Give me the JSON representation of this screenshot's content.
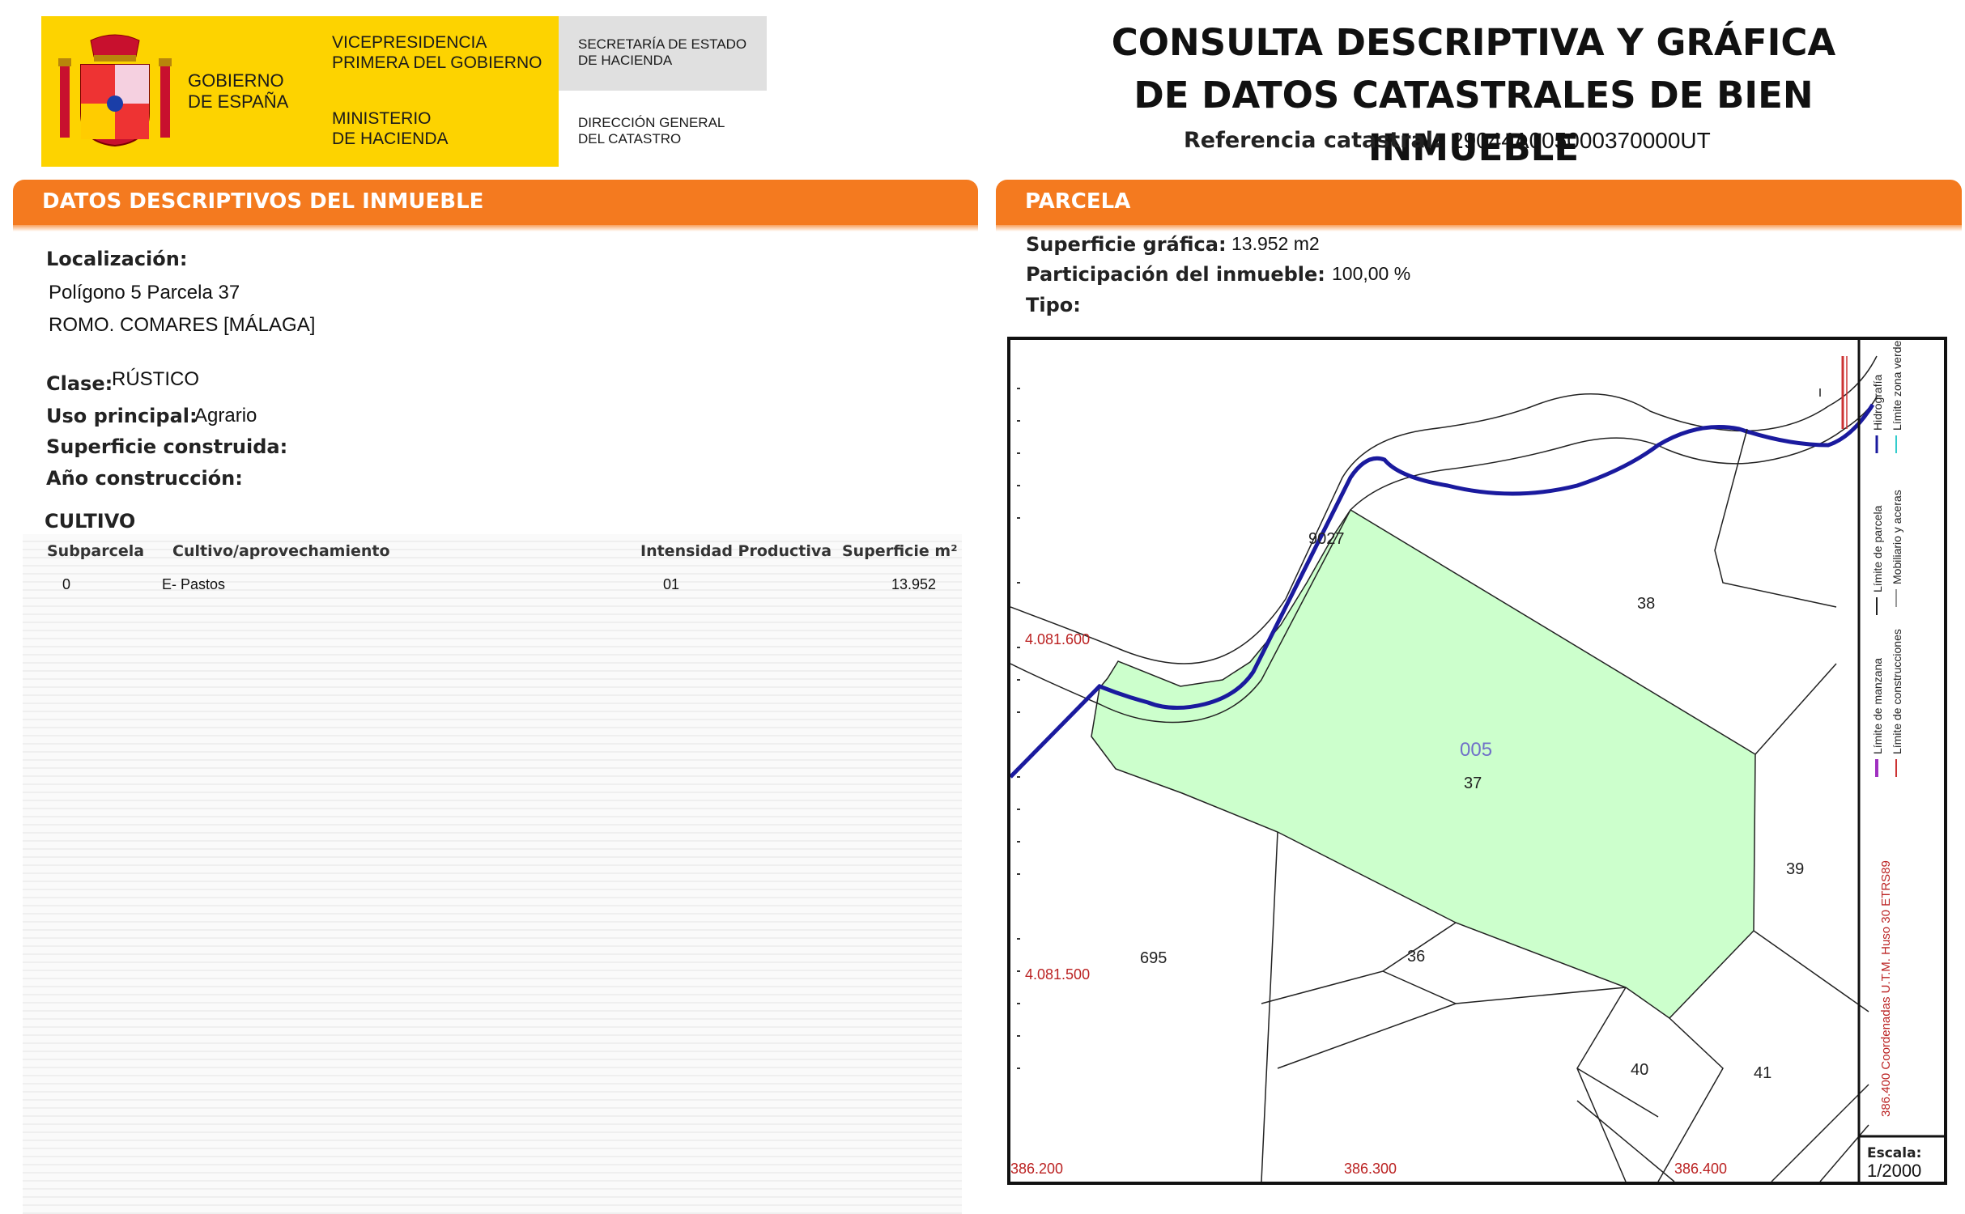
{
  "header": {
    "gobierno": "GOBIERNO\nDE ESPAÑA",
    "vicepresidencia": "VICEPRESIDENCIA\nPRIMERA DEL GOBIERNO",
    "ministerio": "MINISTERIO\nDE HACIENDA",
    "secretaria": "SECRETARÍA DE ESTADO\nDE HACIENDA",
    "direccion": "DIRECCIÓN GENERAL\nDEL CATASTRO",
    "title_line1": "CONSULTA DESCRIPTIVA Y GRÁFICA",
    "title_line2": "DE DATOS CATASTRALES DE BIEN INMUEBLE",
    "ref_label": "Referencia catastral:",
    "ref_value": "29044A005000370000UT"
  },
  "left": {
    "section_title": "DATOS DESCRIPTIVOS DEL INMUEBLE",
    "localizacion_label": "Localización:",
    "localizacion_line1": "Polígono 5 Parcela 37",
    "localizacion_line2": "ROMO. COMARES [MÁLAGA]",
    "clase_label": "Clase:",
    "clase_value": "RÚSTICO",
    "uso_label": "Uso principal:",
    "uso_value": "Agrario",
    "sup_construida_label": "Superficie construida:",
    "anio_label": "Año construcción:",
    "cultivo_title": "CULTIVO",
    "table": {
      "headers": [
        "Subparcela",
        "Cultivo/aprovechamiento",
        "Intensidad Productiva",
        "Superficie m²"
      ],
      "rows": [
        [
          "0",
          "E- Pastos",
          "01",
          "13.952"
        ]
      ]
    }
  },
  "right": {
    "section_title": "PARCELA",
    "sup_grafica_label": "Superficie gráfica:",
    "sup_grafica_value": "13.952 m2",
    "participacion_label": "Participación del inmueble:",
    "participacion_value": "100,00 %",
    "tipo_label": "Tipo:",
    "map": {
      "parcel_labels": [
        "9027",
        "38",
        "005",
        "37",
        "39",
        "695",
        "36",
        "40",
        "41"
      ],
      "y_coords": [
        "4.081.600",
        "4.081.500"
      ],
      "x_coords": [
        "386.200",
        "386.300",
        "386.400"
      ],
      "legend": {
        "hidrografia": "Hidrografía",
        "limite_zona_verde": "Límite zona verde",
        "limite_parcela": "Límite de parcela",
        "mobiliario": "Mobiliario y aceras",
        "limite_manzana": "Límite de manzana",
        "limite_construcciones": "Límite de construcciones",
        "coordenadas": "386.400 Coordenadas U.T.M. Huso 30 ETRS89"
      },
      "escala_label": "Escala:",
      "escala_value": "1/2000",
      "colors": {
        "parcel_fill": "#ccffcc",
        "river": "#1a1a9e",
        "coords": "#b22222",
        "bar": "#f47a1f"
      }
    }
  }
}
